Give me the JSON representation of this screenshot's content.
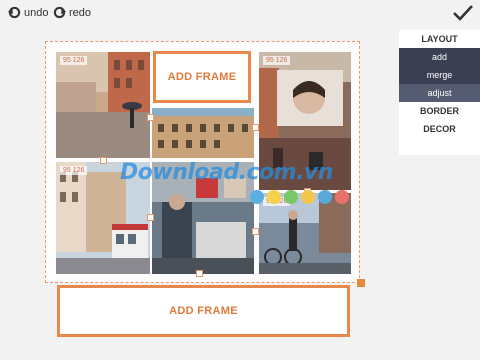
{
  "toolbar": {
    "undo_label": "undo",
    "redo_label": "redo"
  },
  "panel": {
    "layout": "LAYOUT",
    "add": "add",
    "merge": "merge",
    "adjust": "adjust",
    "border": "BORDER",
    "decor": "DECOR"
  },
  "frames": {
    "add_frame_top": "ADD FRAME",
    "add_frame_bottom": "ADD FRAME"
  },
  "badges": {
    "top_left": "95 126",
    "mid_left": "95 126",
    "top_right": "95 126",
    "bottom_right": "95 126"
  },
  "watermark": "Download.com.vn",
  "colors": {
    "accent": "#e8884a",
    "panel_dark": "#3a3f52",
    "background": "#f2f2f2"
  },
  "dot_colors": [
    "#5ab0e0",
    "#f4d24a",
    "#7bc86a",
    "#f3c84a",
    "#5aa8d8",
    "#e8706a"
  ]
}
